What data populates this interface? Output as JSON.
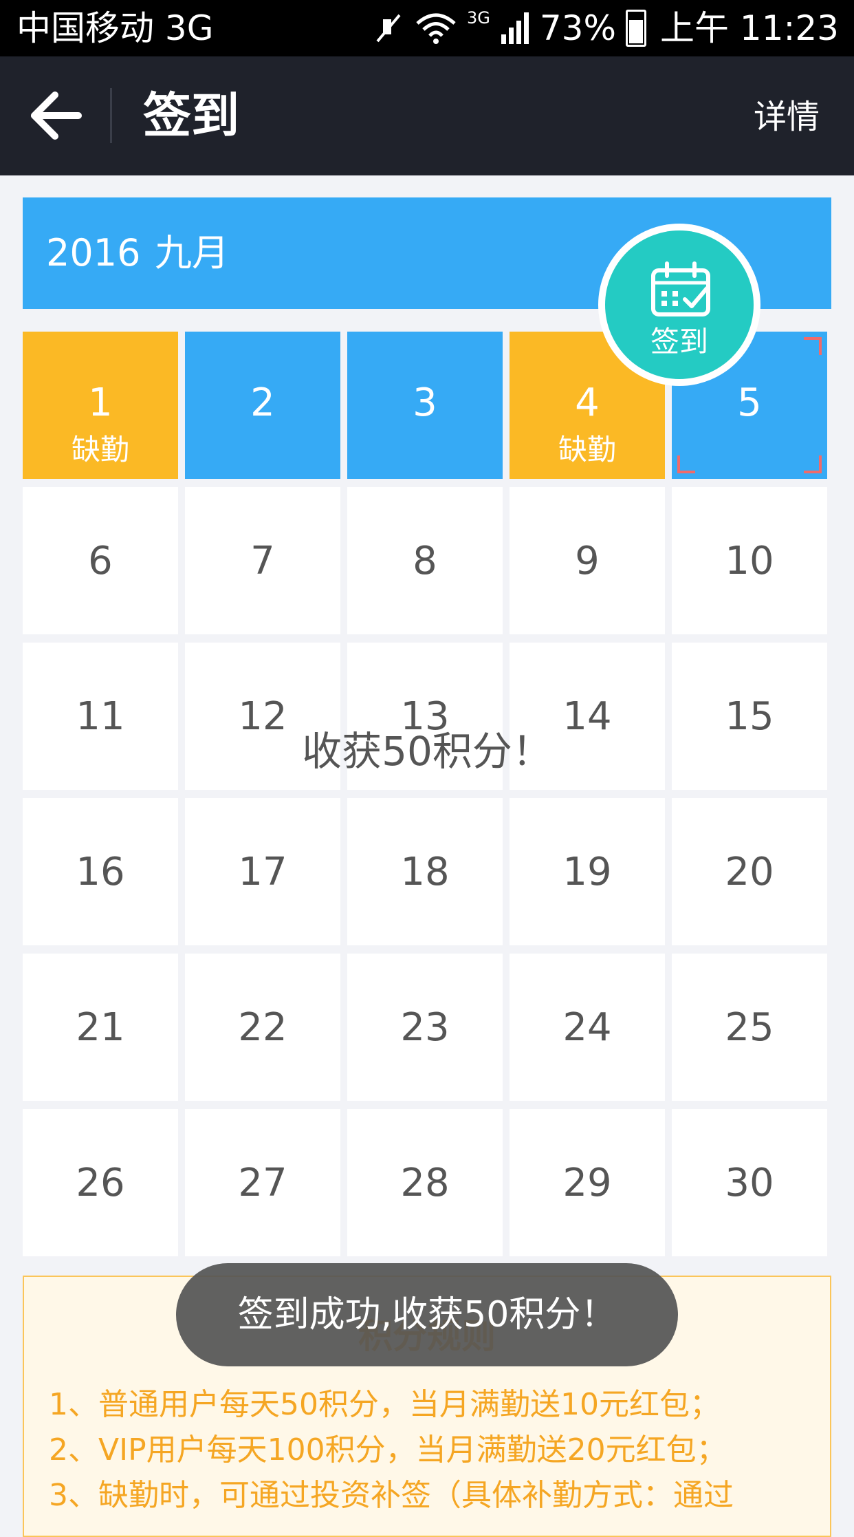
{
  "status_bar": {
    "carrier": "中国移动 3G",
    "network": "3G",
    "battery": "73%",
    "time": "上午 11:23"
  },
  "nav": {
    "title": "签到",
    "detail": "详情"
  },
  "calendar": {
    "year": "2016",
    "month": "九月",
    "checkin_label": "签到",
    "days": [
      {
        "num": "1",
        "state": "absent",
        "label": "缺勤"
      },
      {
        "num": "2",
        "state": "signed",
        "label": ""
      },
      {
        "num": "3",
        "state": "signed",
        "label": ""
      },
      {
        "num": "4",
        "state": "absent",
        "label": "缺勤"
      },
      {
        "num": "5",
        "state": "today",
        "label": ""
      },
      {
        "num": "6"
      },
      {
        "num": "7"
      },
      {
        "num": "8"
      },
      {
        "num": "9"
      },
      {
        "num": "10"
      },
      {
        "num": "11"
      },
      {
        "num": "12"
      },
      {
        "num": "13"
      },
      {
        "num": "14"
      },
      {
        "num": "15"
      },
      {
        "num": "16"
      },
      {
        "num": "17"
      },
      {
        "num": "18"
      },
      {
        "num": "19"
      },
      {
        "num": "20"
      },
      {
        "num": "21"
      },
      {
        "num": "22"
      },
      {
        "num": "23"
      },
      {
        "num": "24"
      },
      {
        "num": "25"
      },
      {
        "num": "26"
      },
      {
        "num": "27"
      },
      {
        "num": "28"
      },
      {
        "num": "29"
      },
      {
        "num": "30"
      }
    ]
  },
  "overlay_message": "收获50积分！",
  "toast": "签到成功,收获50积分！",
  "rules": {
    "title": "积分规则",
    "items": [
      "1、普通用户每天50积分，当月满勤送10元红包；",
      "2、VIP用户每天100积分，当月满勤送20元红包；",
      "3、缺勤时，可通过投资补签（具体补勤方式：通过"
    ]
  },
  "colors": {
    "signed": "#36aaf5",
    "absent": "#fbb925",
    "checkin": "#24cbc3",
    "navbar": "#1f222b"
  }
}
